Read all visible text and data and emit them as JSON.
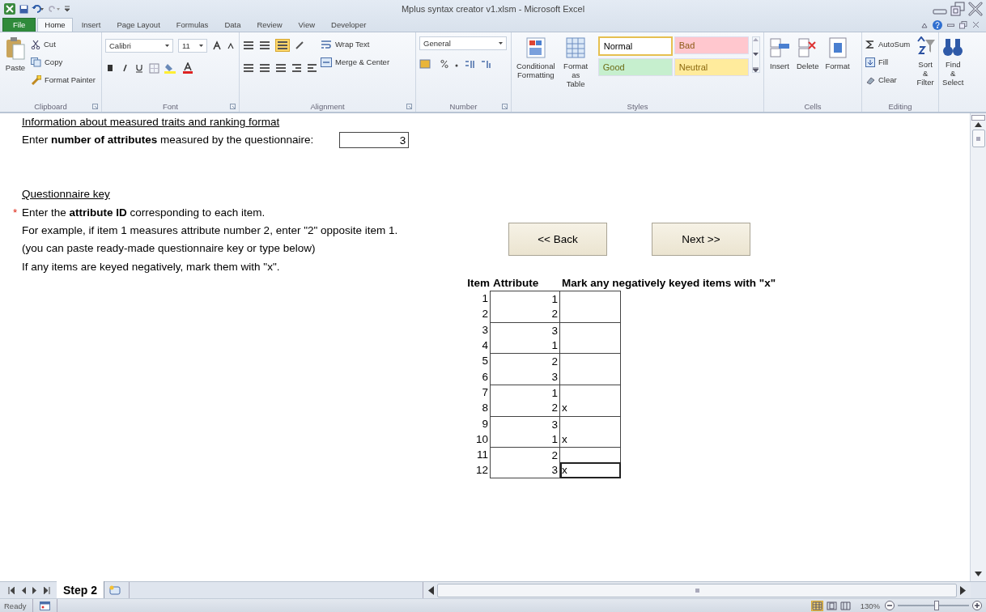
{
  "window": {
    "title": "Mplus syntax creator v1.xlsm - Microsoft Excel"
  },
  "ribbon": {
    "tabs": [
      {
        "label": "File",
        "kind": "file",
        "selected": false
      },
      {
        "label": "Home",
        "kind": "tab",
        "selected": true
      },
      {
        "label": "Insert",
        "kind": "tab",
        "selected": false
      },
      {
        "label": "Page Layout",
        "kind": "tab",
        "selected": false
      },
      {
        "label": "Formulas",
        "kind": "tab",
        "selected": false
      },
      {
        "label": "Data",
        "kind": "tab",
        "selected": false
      },
      {
        "label": "Review",
        "kind": "tab",
        "selected": false
      },
      {
        "label": "View",
        "kind": "tab",
        "selected": false
      },
      {
        "label": "Developer",
        "kind": "tab",
        "selected": false
      }
    ],
    "groups": [
      {
        "kind": "clipboard",
        "label": "Clipboard",
        "large": [
          {
            "lines": [
              "Paste"
            ]
          }
        ],
        "commands": [
          "Cut",
          "Copy",
          "Format Painter"
        ]
      },
      {
        "kind": "font",
        "label": "Font",
        "combos": [
          "Calibri",
          "11"
        ]
      },
      {
        "kind": "alignment",
        "label": "Alignment",
        "commands": [
          "Wrap Text",
          "Merge & Center"
        ]
      },
      {
        "kind": "number",
        "label": "Number",
        "combos": [
          "General"
        ]
      },
      {
        "kind": "styles",
        "label": "Styles",
        "large": [
          {
            "lines": [
              "Conditional",
              "Formatting"
            ]
          },
          {
            "lines": [
              "Format as",
              "Table"
            ]
          }
        ],
        "styles": [
          {
            "label": "Normal",
            "color": "#ffffff",
            "selected": true
          },
          {
            "label": "Bad",
            "color": "#ffc7ce",
            "selected": false
          },
          {
            "label": "Good",
            "color": "#c6efce",
            "selected": false
          },
          {
            "label": "Neutral",
            "color": "#ffeb9c",
            "selected": false
          }
        ]
      },
      {
        "kind": "cells",
        "label": "Cells",
        "large": [
          {
            "lines": [
              "Insert"
            ]
          },
          {
            "lines": [
              "Delete"
            ]
          },
          {
            "lines": [
              "Format"
            ]
          }
        ]
      },
      {
        "kind": "editing",
        "label": "Editing",
        "commands": [
          "AutoSum",
          "Fill",
          "Clear"
        ],
        "large": [
          {
            "lines": [
              "Sort &",
              "Filter"
            ]
          },
          {
            "lines": [
              "Find &",
              "Select"
            ]
          }
        ]
      }
    ]
  },
  "sheet": {
    "heading": "Information about measured traits and ranking format",
    "attributes_prompt": "Enter **number of attributes** measured by the questionnaire:",
    "attributes_value": "3",
    "key_heading": "Questionnaire key",
    "instructions": [
      {
        "text": "Enter the **attribute ID** corresponding to each item.",
        "marker": "*"
      },
      {
        "text": "For example, if item 1 measures attribute number 2, enter \"2\" opposite item 1."
      },
      {
        "text": "(you can paste ready-made questionnaire key or type below)"
      },
      {
        "text": "If any items are keyed negatively, mark them with \"x\"."
      }
    ],
    "buttons": [
      "<< Back",
      "Next >>"
    ],
    "table": {
      "columns": [
        "Item",
        "Attribute",
        "Mark any negatively keyed items with \"x\""
      ],
      "rows": [
        {
          "item": "1",
          "attribute": "1",
          "selected": false
        },
        {
          "item": "2",
          "attribute": "2",
          "selected": false
        },
        {
          "item": "3",
          "attribute": "3",
          "selected": false
        },
        {
          "item": "4",
          "attribute": "1",
          "selected": false
        },
        {
          "item": "5",
          "attribute": "2",
          "selected": false
        },
        {
          "item": "6",
          "attribute": "3",
          "selected": false
        },
        {
          "item": "7",
          "attribute": "1",
          "selected": false
        },
        {
          "item": "8",
          "attribute": "2",
          "mark": "x",
          "selected": false
        },
        {
          "item": "9",
          "attribute": "3",
          "selected": false
        },
        {
          "item": "10",
          "attribute": "1",
          "mark": "x",
          "selected": false
        },
        {
          "item": "11",
          "attribute": "2",
          "selected": false
        },
        {
          "item": "12",
          "attribute": "3",
          "mark": "x",
          "selected": true
        }
      ]
    }
  },
  "sheet_tabs": [
    {
      "label": "Step 2",
      "selected": true
    }
  ],
  "status_bar": {
    "status": "Ready",
    "zoom": "130%",
    "zoom_level": {
      "level": 0.55
    }
  }
}
